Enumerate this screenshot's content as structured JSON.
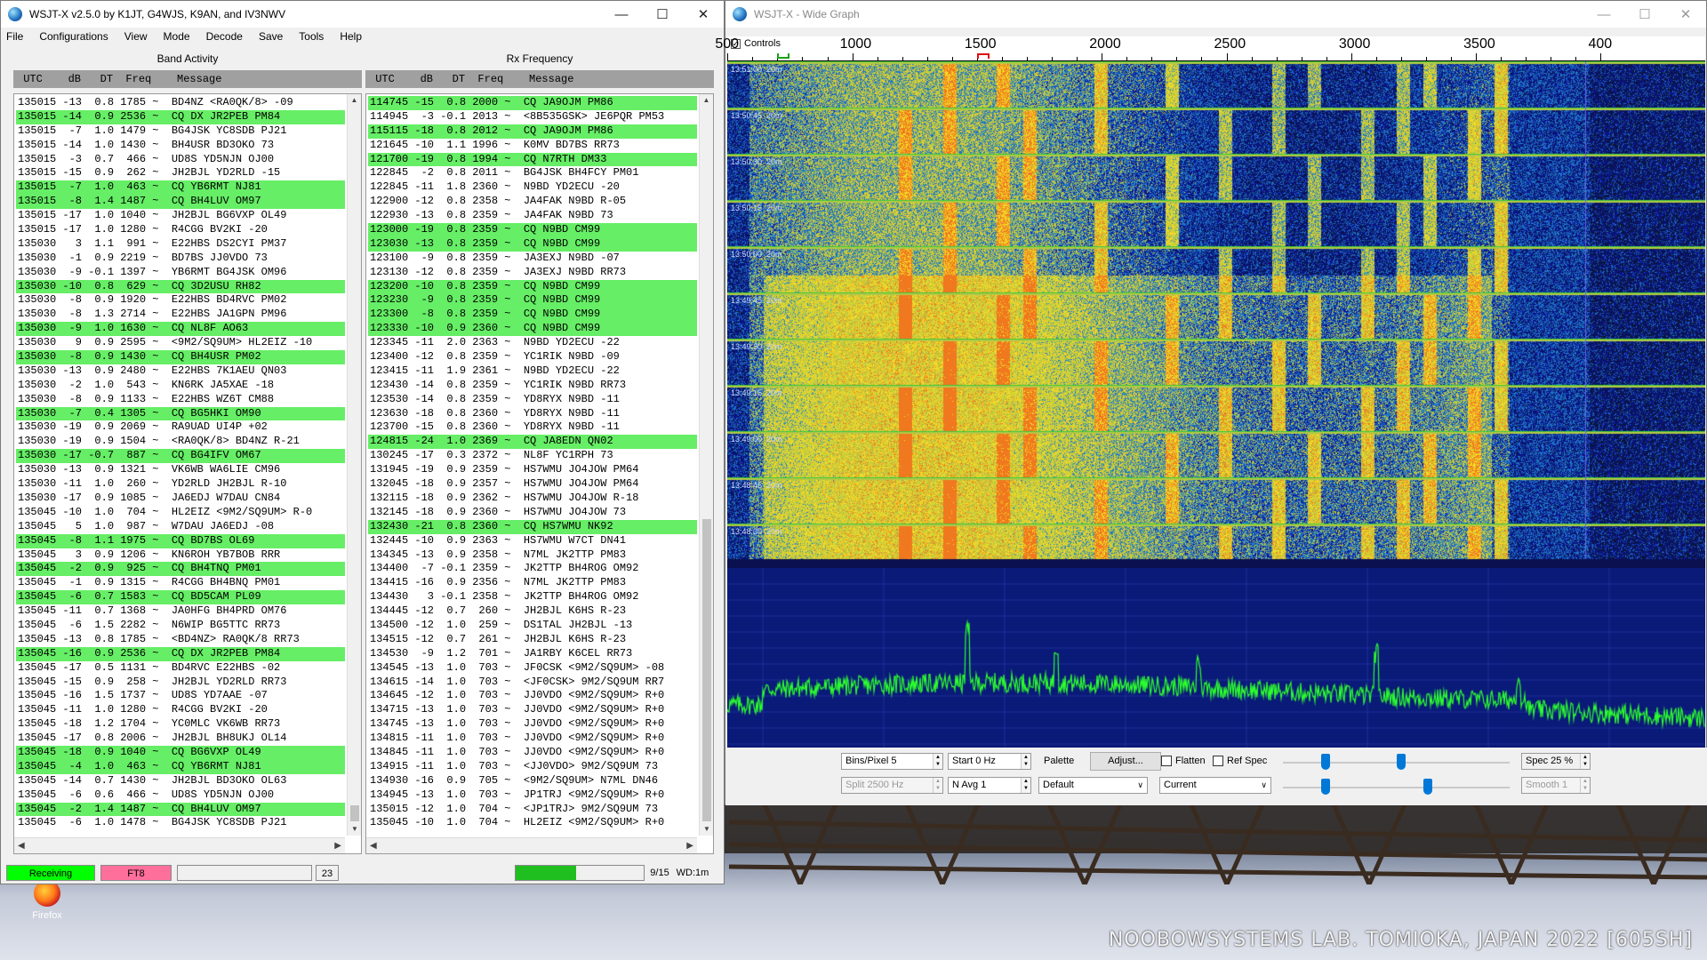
{
  "desktop": {
    "watermark": "NOOBOWSYSTEMS LAB. TOMIOKA, JAPAN 2022 [605SH]",
    "firefox_label": "Firefox"
  },
  "main": {
    "title": "WSJT-X   v2.5.0   by K1JT, G4WJS, K9AN, and IV3NWV",
    "menu": [
      "File",
      "Configurations",
      "View",
      "Mode",
      "Decode",
      "Save",
      "Tools",
      "Help"
    ],
    "band_title": "Band Activity",
    "rx_title": "Rx Frequency",
    "col_header": " UTC    dB   DT  Freq    Message",
    "band_rows": [
      {
        "t": "135015 -13  0.8 1785 ~  BD4NZ <RA0QK/8> -09",
        "cq": false
      },
      {
        "t": "135015 -14  0.9 2536 ~  CQ DX JR2PEB PM84",
        "cq": true
      },
      {
        "t": "135015  -7  1.0 1479 ~  BG4JSK YC8SDB PJ21",
        "cq": false
      },
      {
        "t": "135015 -14  1.0 1430 ~  BH4USR BD3OKO 73",
        "cq": false
      },
      {
        "t": "135015  -3  0.7  466 ~  UD8S YD5NJN OJ00",
        "cq": false
      },
      {
        "t": "135015 -15  0.9  262 ~  JH2BJL YD2RLD -15",
        "cq": false
      },
      {
        "t": "135015  -7  1.0  463 ~  CQ YB6RMT NJ81",
        "cq": true
      },
      {
        "t": "135015  -8  1.4 1487 ~  CQ BH4LUV OM97",
        "cq": true
      },
      {
        "t": "135015 -17  1.0 1040 ~  JH2BJL BG6VXP OL49",
        "cq": false
      },
      {
        "t": "135015 -17  1.0 1280 ~  R4CGG BV2KI -20",
        "cq": false
      },
      {
        "t": "135030   3  1.1  991 ~  E22HBS DS2CYI PM37",
        "cq": false
      },
      {
        "t": "135030  -1  0.9 2219 ~  BD7BS JJ0VDO 73",
        "cq": false
      },
      {
        "t": "135030  -9 -0.1 1397 ~  YB6RMT BG4JSK OM96",
        "cq": false
      },
      {
        "t": "135030 -10  0.8  629 ~  CQ 3D2USU RH82",
        "cq": true
      },
      {
        "t": "135030  -8  0.9 1920 ~  E22HBS BD4RVC PM02",
        "cq": false
      },
      {
        "t": "135030  -8  1.3 2714 ~  E22HBS JA1GPN PM96",
        "cq": false
      },
      {
        "t": "135030  -9  1.0 1630 ~  CQ NL8F AO63",
        "cq": true
      },
      {
        "t": "135030   9  0.9 2595 ~  <9M2/SQ9UM> HL2EIZ -10",
        "cq": false
      },
      {
        "t": "135030  -8  0.9 1430 ~  CQ BH4USR PM02",
        "cq": true
      },
      {
        "t": "135030 -13  0.9 2480 ~  E22HBS 7K1AEU QN03",
        "cq": false
      },
      {
        "t": "135030  -2  1.0  543 ~  KN6RK JA5XAE -18",
        "cq": false
      },
      {
        "t": "135030  -8  0.9 1133 ~  E22HBS WZ6T CM88",
        "cq": false
      },
      {
        "t": "135030  -7  0.4 1305 ~  CQ BG5HKI OM90",
        "cq": true
      },
      {
        "t": "135030 -19  0.9 2069 ~  RA9UAD UI4P +02",
        "cq": false
      },
      {
        "t": "135030 -19  0.9 1504 ~  <RA0QK/8> BD4NZ R-21",
        "cq": false
      },
      {
        "t": "135030 -17 -0.7  887 ~  CQ BG4IFV OM67",
        "cq": true
      },
      {
        "t": "135030 -13  0.9 1321 ~  VK6WB WA6LIE CM96",
        "cq": false
      },
      {
        "t": "135030 -11  1.0  260 ~  YD2RLD JH2BJL R-10",
        "cq": false
      },
      {
        "t": "135030 -17  0.9 1085 ~  JA6EDJ W7DAU CN84",
        "cq": false
      },
      {
        "t": "135045 -10  1.0  704 ~  HL2EIZ <9M2/SQ9UM> R-0",
        "cq": false
      },
      {
        "t": "135045   5  1.0  987 ~  W7DAU JA6EDJ -08",
        "cq": false
      },
      {
        "t": "135045  -8  1.1 1975 ~  CQ BD7BS OL69",
        "cq": true
      },
      {
        "t": "135045   3  0.9 1206 ~  KN6ROH YB7BOB RRR",
        "cq": false
      },
      {
        "t": "135045  -2  0.9  925 ~  CQ BH4TNQ PM01",
        "cq": true
      },
      {
        "t": "135045  -1  0.9 1315 ~  R4CGG BH4BNQ PM01",
        "cq": false
      },
      {
        "t": "135045  -6  0.7 1583 ~  CQ BD5CAM PL09",
        "cq": true
      },
      {
        "t": "135045 -11  0.7 1368 ~  JA0HFG BH4PRD OM76",
        "cq": false
      },
      {
        "t": "135045  -6  1.5 2282 ~  N6WIP BG5TTC RR73",
        "cq": false
      },
      {
        "t": "135045 -13  0.8 1785 ~  <BD4NZ> RA0QK/8 RR73",
        "cq": false
      },
      {
        "t": "135045 -16  0.9 2536 ~  CQ DX JR2PEB PM84",
        "cq": true
      },
      {
        "t": "135045 -17  0.5 1131 ~  BD4RVC E22HBS -02",
        "cq": false
      },
      {
        "t": "135045 -15  0.9  258 ~  JH2BJL YD2RLD RR73",
        "cq": false
      },
      {
        "t": "135045 -16  1.5 1737 ~  UD8S YD7AAE -07",
        "cq": false
      },
      {
        "t": "135045 -11  1.0 1280 ~  R4CGG BV2KI -20",
        "cq": false
      },
      {
        "t": "135045 -18  1.2 1704 ~  YC0MLC VK6WB RR73",
        "cq": false
      },
      {
        "t": "135045 -17  0.8 2006 ~  JH2BJL BH8UKJ OL14",
        "cq": false
      },
      {
        "t": "135045 -18  0.9 1040 ~  CQ BG6VXP OL49",
        "cq": true
      },
      {
        "t": "135045  -4  1.0  463 ~  CQ YB6RMT NJ81",
        "cq": true
      },
      {
        "t": "135045 -14  0.7 1430 ~  JH2BJL BD3OKO OL63",
        "cq": false
      },
      {
        "t": "135045  -6  0.6  466 ~  UD8S YD5NJN OJ00",
        "cq": false
      },
      {
        "t": "135045  -2  1.4 1487 ~  CQ BH4LUV OM97",
        "cq": true
      },
      {
        "t": "135045  -6  1.0 1478 ~  BG4JSK YC8SDB PJ21",
        "cq": false
      }
    ],
    "rx_rows": [
      {
        "t": "114745 -15  0.8 2000 ~  CQ JA9OJM PM86",
        "cq": true
      },
      {
        "t": "114945  -3 -0.1 2013 ~  <8B535GSK> JE6PQR PM53",
        "cq": false
      },
      {
        "t": "115115 -18  0.8 2012 ~  CQ JA9OJM PM86",
        "cq": true
      },
      {
        "t": "121645 -10  1.1 1996 ~  K0MV BD7BS RR73",
        "cq": false
      },
      {
        "t": "121700 -19  0.8 1994 ~  CQ N7RTH DM33",
        "cq": true
      },
      {
        "t": "122845  -2  0.8 2011 ~  BG4JSK BH4FCY PM01",
        "cq": false
      },
      {
        "t": "122845 -11  1.8 2360 ~  N9BD YD2ECU -20",
        "cq": false
      },
      {
        "t": "122900 -12  0.8 2358 ~  JA4FAK N9BD R-05",
        "cq": false
      },
      {
        "t": "122930 -13  0.8 2359 ~  JA4FAK N9BD 73",
        "cq": false
      },
      {
        "t": "123000 -19  0.8 2359 ~  CQ N9BD CM99",
        "cq": true
      },
      {
        "t": "123030 -13  0.8 2359 ~  CQ N9BD CM99",
        "cq": true
      },
      {
        "t": "123100  -9  0.8 2359 ~  JA3EXJ N9BD -07",
        "cq": false
      },
      {
        "t": "123130 -12  0.8 2359 ~  JA3EXJ N9BD RR73",
        "cq": false
      },
      {
        "t": "123200 -10  0.8 2359 ~  CQ N9BD CM99",
        "cq": true
      },
      {
        "t": "123230  -9  0.8 2359 ~  CQ N9BD CM99",
        "cq": true
      },
      {
        "t": "123300  -8  0.8 2359 ~  CQ N9BD CM99",
        "cq": true
      },
      {
        "t": "123330 -10  0.9 2360 ~  CQ N9BD CM99",
        "cq": true
      },
      {
        "t": "123345 -11  2.0 2363 ~  N9BD YD2ECU -22",
        "cq": false
      },
      {
        "t": "123400 -12  0.8 2359 ~  YC1RIK N9BD -09",
        "cq": false
      },
      {
        "t": "123415 -11  1.9 2361 ~  N9BD YD2ECU -22",
        "cq": false
      },
      {
        "t": "123430 -14  0.8 2359 ~  YC1RIK N9BD RR73",
        "cq": false
      },
      {
        "t": "123530 -14  0.8 2359 ~  YD8RYX N9BD -11",
        "cq": false
      },
      {
        "t": "123630 -18  0.8 2360 ~  YD8RYX N9BD -11",
        "cq": false
      },
      {
        "t": "123700 -15  0.8 2360 ~  YD8RYX N9BD -11",
        "cq": false
      },
      {
        "t": "124815 -24  1.0 2369 ~  CQ JA8EDN QN02",
        "cq": true
      },
      {
        "t": "130245 -17  0.3 2372 ~  NL8F YC1RPH 73",
        "cq": false
      },
      {
        "t": "131945 -19  0.9 2359 ~  HS7WMU JO4JOW PM64",
        "cq": false
      },
      {
        "t": "132045 -18  0.9 2357 ~  HS7WMU JO4JOW PM64",
        "cq": false
      },
      {
        "t": "132115 -18  0.9 2362 ~  HS7WMU JO4JOW R-18",
        "cq": false
      },
      {
        "t": "132145 -18  0.9 2360 ~  HS7WMU JO4JOW 73",
        "cq": false
      },
      {
        "t": "132430 -21  0.8 2360 ~  CQ HS7WMU NK92",
        "cq": true
      },
      {
        "t": "132445 -10  0.9 2363 ~  HS7WMU W7CT DN41",
        "cq": false
      },
      {
        "t": "134345 -13  0.9 2358 ~  N7ML JK2TTP PM83",
        "cq": false
      },
      {
        "t": "134400  -7 -0.1 2359 ~  JK2TTP BH4ROG OM92",
        "cq": false
      },
      {
        "t": "134415 -16  0.9 2356 ~  N7ML JK2TTP PM83",
        "cq": false
      },
      {
        "t": "134430   3 -0.1 2358 ~  JK2TTP BH4ROG OM92",
        "cq": false
      },
      {
        "t": "134445 -12  0.7  260 ~  JH2BJL K6HS R-23",
        "cq": false
      },
      {
        "t": "134500 -12  1.0  259 ~  DS1TAL JH2BJL -13",
        "cq": false
      },
      {
        "t": "134515 -12  0.7  261 ~  JH2BJL K6HS R-23",
        "cq": false
      },
      {
        "t": "134530  -9  1.2  701 ~  JA1RBY K6CEL RR73",
        "cq": false
      },
      {
        "t": "134545 -13  1.0  703 ~  JF0CSK <9M2/SQ9UM> -08",
        "cq": false
      },
      {
        "t": "134615 -14  1.0  703 ~  <JF0CSK> 9M2/SQ9UM RR7",
        "cq": false
      },
      {
        "t": "134645 -12  1.0  703 ~  JJ0VDO <9M2/SQ9UM> R+0",
        "cq": false
      },
      {
        "t": "134715 -13  1.0  703 ~  JJ0VDO <9M2/SQ9UM> R+0",
        "cq": false
      },
      {
        "t": "134745 -13  1.0  703 ~  JJ0VDO <9M2/SQ9UM> R+0",
        "cq": false
      },
      {
        "t": "134815 -11  1.0  703 ~  JJ0VDO <9M2/SQ9UM> R+0",
        "cq": false
      },
      {
        "t": "134845 -11  1.0  703 ~  JJ0VDO <9M2/SQ9UM> R+0",
        "cq": false
      },
      {
        "t": "134915 -11  1.0  703 ~  <JJ0VDO> 9M2/SQ9UM 73",
        "cq": false
      },
      {
        "t": "134930 -16  0.9  705 ~  <9M2/SQ9UM> N7ML DN46",
        "cq": false
      },
      {
        "t": "134945 -13  1.0  703 ~  JP1TRJ <9M2/SQ9UM> R+0",
        "cq": false
      },
      {
        "t": "135015 -12  1.0  704 ~  <JP1TRJ> 9M2/SQ9UM 73",
        "cq": false
      },
      {
        "t": "135045 -10  1.0  704 ~  HL2EIZ <9M2/SQ9UM> R+0",
        "cq": false
      }
    ],
    "status": {
      "receiving": "Receiving",
      "mode": "FT8",
      "blank": "",
      "count": "23",
      "progress_fraction": 0.47,
      "period": "9/15",
      "wd": "WD:1m"
    },
    "colors": {
      "cq": "#66ee66",
      "receiving": "#00ff00",
      "mode": "#ff6f9c",
      "progress": "#1fbf1f"
    }
  },
  "wide_graph": {
    "title": "WSJT-X - Wide Graph",
    "controls_label": "Controls",
    "freq_labels": [
      "500",
      "1000",
      "1500",
      "2000",
      "2500",
      "3000",
      "3500",
      "400"
    ],
    "time_labels": [
      "13:51:00",
      "13:50:45",
      "13:50:30",
      "13:50:15",
      "13:50:00",
      "13:49:45",
      "13:49:30",
      "13:49:15",
      "13:49:00",
      "13:48:45",
      "13:48:30"
    ],
    "band_label": "20m",
    "bins_per_pixel": "Bins/Pixel  5",
    "start": "Start  0 Hz",
    "palette": "Palette",
    "adjust": "Adjust...",
    "flatten": "Flatten",
    "ref_spec": "Ref Spec",
    "spec": "Spec  25 %",
    "split": "Split   2500  Hz",
    "navg": "N Avg  1",
    "palette_sel": "Default",
    "spectrum_sel": "Current",
    "smooth": "Smooth    1"
  }
}
